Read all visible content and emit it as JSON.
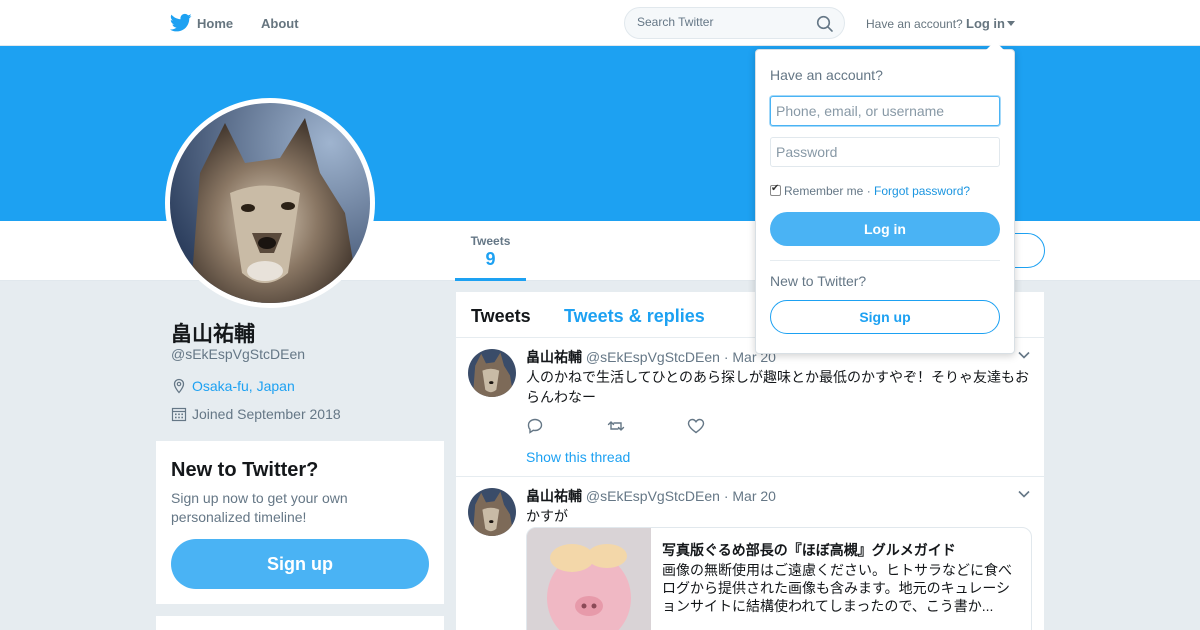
{
  "nav": {
    "home": "Home",
    "about": "About",
    "search_placeholder": "Search Twitter",
    "have_account": "Have an account?",
    "login_toggle": "Log in"
  },
  "profile": {
    "name": "畠山祐輔",
    "handle": "@sEkEspVgStcDEen",
    "location": "Osaka-fu, Japan",
    "joined": "Joined September 2018",
    "stats": {
      "tweets_label": "Tweets",
      "tweets_value": "9"
    }
  },
  "new_to_twitter": {
    "title": "New to Twitter?",
    "text": "Sign up now to get your own personalized timeline!",
    "signup": "Sign up"
  },
  "timeline": {
    "tabs": [
      "Tweets",
      "Tweets & replies"
    ],
    "tweets": [
      {
        "name": "畠山祐輔",
        "handle": "@sEkEspVgStcDEen",
        "dot": "·",
        "time": "Mar 20",
        "text": "人のかねで生活してひとのあら探しが趣味とか最低のかすやぞ！そりゃ友達もおらんわなー",
        "thread_link": "Show this thread"
      },
      {
        "name": "畠山祐輔",
        "handle": "@sEkEspVgStcDEen",
        "dot": "·",
        "time": "Mar 20",
        "text": "かすが",
        "card": {
          "title": "写真版ぐるめ部長の『ほぼ高槻』グルメガイド",
          "description": "画像の無断使用はご遠慮ください。ヒトサラなどに食べログから提供された画像も含みます。地元のキュレーションサイトに結構使われてしまったので、こう書か..."
        }
      }
    ]
  },
  "login_dropdown": {
    "title": "Have an account?",
    "phone_placeholder": "Phone, email, or username",
    "password_placeholder": "Password",
    "remember": "Remember me",
    "separator": "·",
    "forgot": "Forgot password?",
    "login_button": "Log in",
    "new_prompt": "New to Twitter?",
    "signup_button": "Sign up"
  },
  "colors": {
    "brand": "#1da1f2",
    "button": "#4ab3f4",
    "background": "#e6ecf0"
  },
  "icons": [
    "twitter-bird-icon",
    "search-icon",
    "location-icon",
    "calendar-icon",
    "reply-icon",
    "retweet-icon",
    "like-icon",
    "chevron-down-icon"
  ]
}
